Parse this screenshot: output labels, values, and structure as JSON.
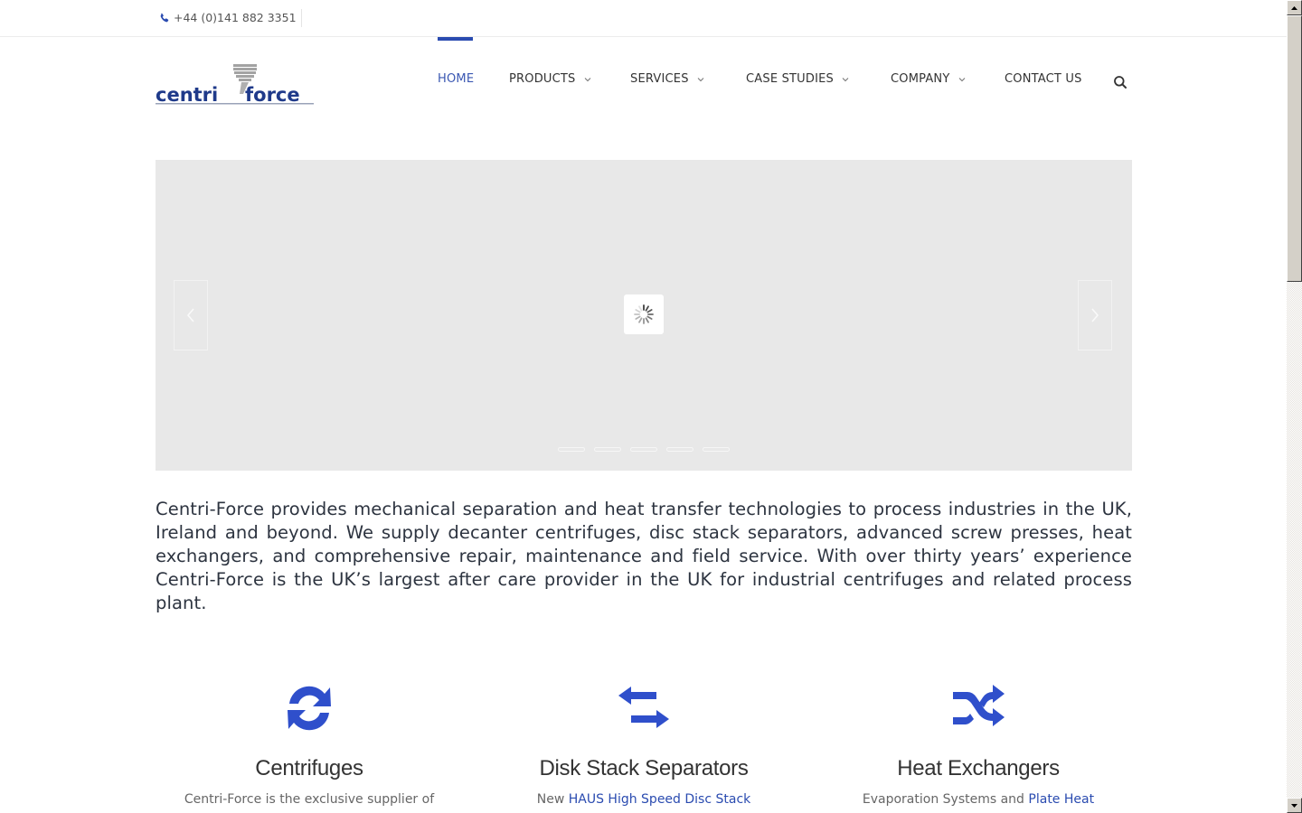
{
  "topbar": {
    "phone_icon": "phone-icon",
    "phone": "+44 (0)141 882 3351"
  },
  "logo": {
    "text_left": "centri",
    "text_right": "force"
  },
  "nav": {
    "items": [
      {
        "label": "HOME",
        "active": true,
        "dropdown": false
      },
      {
        "label": "PRODUCTS",
        "active": false,
        "dropdown": true
      },
      {
        "label": "SERVICES",
        "active": false,
        "dropdown": true
      },
      {
        "label": "CASE STUDIES",
        "active": false,
        "dropdown": true
      },
      {
        "label": "COMPANY",
        "active": false,
        "dropdown": true
      },
      {
        "label": "CONTACT US",
        "active": false,
        "dropdown": false
      }
    ],
    "search_icon": "search-icon"
  },
  "slider": {
    "state": "loading",
    "prev_icon": "chevron-left-icon",
    "next_icon": "chevron-right-icon",
    "slide_count": 5
  },
  "intro": {
    "text": "Centri-Force provides mechanical separation and heat transfer technologies to process industries in the UK, Ireland and beyond. We supply decanter centrifuges, disc stack separators, advanced screw presses, heat exchangers, and comprehensive repair, maintenance and field service. With over thirty years’ experience Centri-Force is the UK’s largest after care provider in the UK for industrial centrifuges and related process plant."
  },
  "features": [
    {
      "icon": "refresh-icon",
      "title": "Centrifuges",
      "text_before": "Centri-Force is the exclusive supplier of",
      "link": "",
      "text_after": ""
    },
    {
      "icon": "exchange-arrows-icon",
      "title": "Disk Stack Separators",
      "text_before": "New ",
      "link": "HAUS High Speed Disc Stack",
      "text_after": ""
    },
    {
      "icon": "shuffle-icon",
      "title": "Heat Exchangers",
      "text_before": "Evaporation Systems and ",
      "link": "Plate Heat",
      "text_after": ""
    }
  ],
  "colors": {
    "accent": "#2a4bb0",
    "icon_blue": "#2f4fcb",
    "slider_bg": "#e8e8e8",
    "body_text": "#2d3440"
  }
}
